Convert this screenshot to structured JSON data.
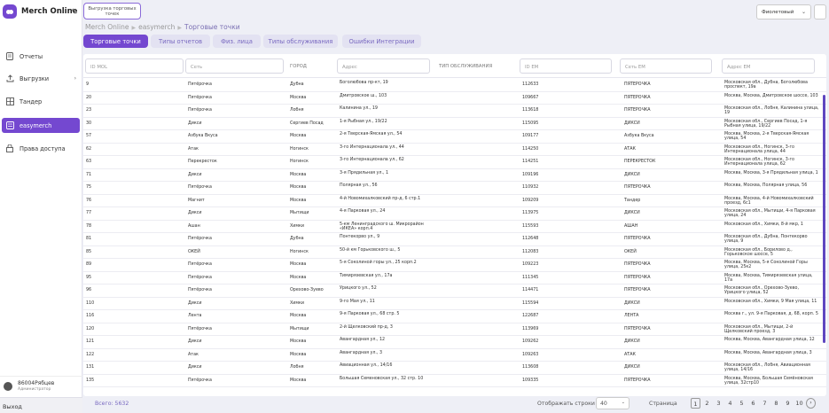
{
  "app": {
    "title": "Merch Online"
  },
  "sidebar": {
    "items": [
      {
        "label": "Отчеты",
        "icon": "document-icon"
      },
      {
        "label": "Выгрузки",
        "icon": "upload-icon"
      },
      {
        "label": "Тандер",
        "icon": "grid-icon"
      },
      {
        "label": "easymerch",
        "icon": "folder-icon"
      },
      {
        "label": "Права доступа",
        "icon": "lock-icon"
      }
    ]
  },
  "user": {
    "name": "86004Рябцев",
    "role": "Администратор"
  },
  "logout_label": "Выход",
  "toolbar": {
    "export_label": "Выгрузка торговых точек",
    "theme_value": "Фиолетовый"
  },
  "breadcrumb": [
    "Merch Online",
    "easymerch",
    "Торговые точки"
  ],
  "tabs": [
    "Торговые точки",
    "Типы отчетов",
    "Физ. лица",
    "Типы обслуживания",
    "Ошибки Интеграции"
  ],
  "filters": {
    "id_mol": "ID MOL",
    "set": "Сеть",
    "city": "ГОРОД",
    "address": "Адрес",
    "service_type": "ТИП ОБСЛУЖИВАНИЯ",
    "id_em": "ID EM",
    "set_em": "Сеть EM",
    "address_em": "Адрес EM"
  },
  "rows": [
    {
      "id": "9",
      "net": "Пятёрочка",
      "city": "Дубна",
      "addr": "Боголюбова пр-кт, 19",
      "idem": "112633",
      "netem": "ПЯТЕРОЧКА",
      "addrem": "Московская обл., Дубна, Боголюбова проспект, 19а"
    },
    {
      "id": "20",
      "net": "Пятёрочка",
      "city": "Москва",
      "addr": "Дмитровское ш., 103",
      "idem": "109667",
      "netem": "ПЯТЕРОЧКА",
      "addrem": "Москва, Москва, Дмитровское шоссе, 103"
    },
    {
      "id": "23",
      "net": "Пятёрочка",
      "city": "Лобня",
      "addr": "Калинина ул., 19",
      "idem": "113618",
      "netem": "ПЯТЕРОЧКА",
      "addrem": "Московская обл., Лобня, Калинина улица, 19"
    },
    {
      "id": "30",
      "net": "Дикси",
      "city": "Сергиев Посад",
      "addr": "1-я Рыбная ул., 19/22",
      "idem": "115095",
      "netem": "ДИКСИ",
      "addrem": "Московская обл., Сергиев Посад, 1-я Рыбная улица, 19/22"
    },
    {
      "id": "57",
      "net": "Азбука Вкуса",
      "city": "Москва",
      "addr": "2-я Тверская-Ямская ул., 54",
      "idem": "109177",
      "netem": "Азбука Вкуса",
      "addrem": "Москва, Москва, 2-я Тверская-Ямская улица, 54"
    },
    {
      "id": "62",
      "net": "Атак",
      "city": "Ногинск",
      "addr": "3-го Интернационала ул., 44",
      "idem": "114250",
      "netem": "АТАК",
      "addrem": "Московская обл., Ногинск, 3-го Интернационала улица, 44"
    },
    {
      "id": "63",
      "net": "Перекресток",
      "city": "Ногинск",
      "addr": "3-го Интернационала ул., 62",
      "idem": "114251",
      "netem": "ПЕРЕКРЕСТОК",
      "addrem": "Московская обл., Ногинск, 3-го Интернационала улица, 62"
    },
    {
      "id": "71",
      "net": "Дикси",
      "city": "Москва",
      "addr": "3-я Прядильная ул., 1",
      "idem": "109196",
      "netem": "ДИКСИ",
      "addrem": "Москва, Москва, 3-я Прядильная улица, 1"
    },
    {
      "id": "75",
      "net": "Пятёрочка",
      "city": "Москва",
      "addr": "Полярная ул., 56",
      "idem": "110932",
      "netem": "ПЯТЕРОЧКА",
      "addrem": "Москва, Москва, Полярная улица, 56"
    },
    {
      "id": "76",
      "net": "Магнит",
      "city": "Москва",
      "addr": "4-й Новомихалковский пр-д, 6 стр.1",
      "idem": "109209",
      "netem": "Тандер",
      "addrem": "Москва, Москва, 4-й Новомихалковский проезд, 6с1"
    },
    {
      "id": "77",
      "net": "Дикси",
      "city": "Мытищи",
      "addr": "4-я Парковая ул., 24",
      "idem": "113975",
      "netem": "ДИКСИ",
      "addrem": "Московская обл., Мытищи, 4-я Парковая улица, 24"
    },
    {
      "id": "78",
      "net": "Ашан",
      "city": "Химки",
      "addr": "5-км Ленинградского ш. Микрорайон «ИКЕА» корп.4",
      "idem": "115593",
      "netem": "АШАН",
      "addrem": "Московская обл., Химки, 8-й мкр, 1"
    },
    {
      "id": "81",
      "net": "Пятёрочка",
      "city": "Дубна",
      "addr": "Понтекорво ул., 9",
      "idem": "112648",
      "netem": "ПЯТЕРОЧКА",
      "addrem": "Московская обл., Дубна, Понтекорво улица, 9"
    },
    {
      "id": "85",
      "net": "ОКЕЙ",
      "city": "Ногинск",
      "addr": "50-й км Горьковского ш., 5",
      "idem": "112083",
      "netem": "ОКЕЙ",
      "addrem": "Московская обл., Борилово д., Горьковское шоссе, 5"
    },
    {
      "id": "89",
      "net": "Пятёрочка",
      "city": "Москва",
      "addr": "5-я Соколиной горы ул., 25 корп.2",
      "idem": "109223",
      "netem": "ПЯТЕРОЧКА",
      "addrem": "Москва, Москва, 5-я Соколиной Горы улица, 25к2"
    },
    {
      "id": "95",
      "net": "Пятёрочка",
      "city": "Москва",
      "addr": "Тимирязевская ул., 17а",
      "idem": "111345",
      "netem": "ПЯТЕРОЧКА",
      "addrem": "Москва, Москва, Тимирязевская улица, 17а"
    },
    {
      "id": "96",
      "net": "Пятёрочка",
      "city": "Орехово-Зуево",
      "addr": "Урицкого ул., 52",
      "idem": "114471",
      "netem": "ПЯТЕРОЧКА",
      "addrem": "Московская обл., Орехово-Зуево, Урицкого улица, 52"
    },
    {
      "id": "110",
      "net": "Дикси",
      "city": "Химки",
      "addr": "9-го Мая ул., 11",
      "idem": "115594",
      "netem": "ДИКСИ",
      "addrem": "Московская обл., Химки, 9 Мая улица, 11"
    },
    {
      "id": "116",
      "net": "Лента",
      "city": "Москва",
      "addr": "9-я Парковая ул., 68 стр. 5",
      "idem": "122687",
      "netem": "ЛЕНТА",
      "addrem": "Москва г., ул. 9-я Парковая, д. 68, корп. 5"
    },
    {
      "id": "120",
      "net": "Пятёрочка",
      "city": "Мытищи",
      "addr": "2-й Щелковский пр-д, 3",
      "idem": "113969",
      "netem": "ПЯТЕРОЧКА",
      "addrem": "Московская обл., Мытищи, 2-й Щелковский проезд, 3"
    },
    {
      "id": "121",
      "net": "Дикси",
      "city": "Москва",
      "addr": "Авангардная ул., 12",
      "idem": "109262",
      "netem": "ДИКСИ",
      "addrem": "Москва, Москва, Авангардная улица, 12"
    },
    {
      "id": "122",
      "net": "Атак",
      "city": "Москва",
      "addr": "Авангардная ул., 3",
      "idem": "109263",
      "netem": "АТАК",
      "addrem": "Москва, Москва, Авангардная улица, 3"
    },
    {
      "id": "131",
      "net": "Дикси",
      "city": "Лобня",
      "addr": "Авиационная ул., 14/16",
      "idem": "113608",
      "netem": "ДИКСИ",
      "addrem": "Московская обл., Лобня, Авиационная улица, 14/16"
    },
    {
      "id": "135",
      "net": "Пятёрочка",
      "city": "Москва",
      "addr": "Большая Семеновская ул., 32 стр. 10",
      "idem": "109335",
      "netem": "ПЯТЕРОЧКА",
      "addrem": "Москва, Москва, Большая Семёновская улица, 32стр10"
    }
  ],
  "footer": {
    "total": "Всего: 5632",
    "rows_per_page_label": "Отображать строки",
    "rows_per_page": "40",
    "page_label": "Страница",
    "pages": [
      "1",
      "2",
      "3",
      "4",
      "5",
      "6",
      "7",
      "8",
      "9",
      "10"
    ],
    "next": "›"
  },
  "colors": {
    "accent": "#7448d0",
    "background": "#eeeff6"
  }
}
